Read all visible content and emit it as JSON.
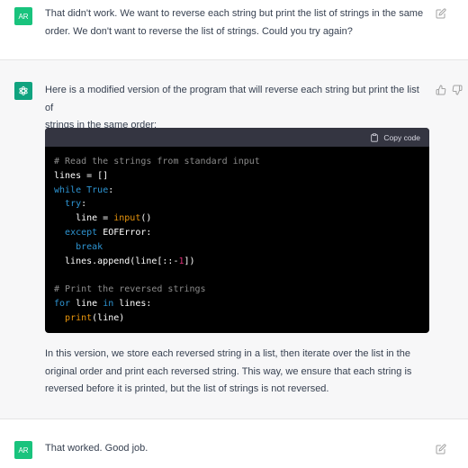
{
  "conversation": {
    "user_message_1": {
      "avatar": "AR",
      "lines": [
        "That didn't work. We want to reverse each string but print the list of strings in the same",
        "order. We don't want to reverse the list of strings. Could you try again?"
      ]
    },
    "assistant_message": {
      "intro_lines": [
        "Here is a modified version of the program that will reverse each string but print the list of",
        "strings in the same order:"
      ],
      "code": {
        "copy_label": "Copy code",
        "lines": [
          [
            {
              "t": "# Read the strings from standard input",
              "c": "c-comment"
            }
          ],
          [
            {
              "t": "lines = []",
              "c": ""
            }
          ],
          [
            {
              "t": "while",
              "c": "c-keyword"
            },
            {
              "t": " ",
              "c": ""
            },
            {
              "t": "True",
              "c": "c-keyword"
            },
            {
              "t": ":",
              "c": ""
            }
          ],
          [
            {
              "t": "  ",
              "c": ""
            },
            {
              "t": "try",
              "c": "c-keyword"
            },
            {
              "t": ":",
              "c": ""
            }
          ],
          [
            {
              "t": "    line = ",
              "c": ""
            },
            {
              "t": "input",
              "c": "c-builtin"
            },
            {
              "t": "()",
              "c": ""
            }
          ],
          [
            {
              "t": "  ",
              "c": ""
            },
            {
              "t": "except",
              "c": "c-keyword"
            },
            {
              "t": " EOFError:",
              "c": ""
            }
          ],
          [
            {
              "t": "    ",
              "c": ""
            },
            {
              "t": "break",
              "c": "c-keyword"
            }
          ],
          [
            {
              "t": "  lines.append(line[::-",
              "c": ""
            },
            {
              "t": "1",
              "c": "c-num"
            },
            {
              "t": "])",
              "c": ""
            }
          ],
          [
            {
              "t": "",
              "c": ""
            }
          ],
          [
            {
              "t": "# Print the reversed strings",
              "c": "c-comment"
            }
          ],
          [
            {
              "t": "for",
              "c": "c-keyword"
            },
            {
              "t": " line ",
              "c": ""
            },
            {
              "t": "in",
              "c": "c-keyword"
            },
            {
              "t": " lines:",
              "c": ""
            }
          ],
          [
            {
              "t": "  ",
              "c": ""
            },
            {
              "t": "print",
              "c": "c-builtin"
            },
            {
              "t": "(line)",
              "c": ""
            }
          ]
        ]
      },
      "outro_lines": [
        "In this version, we store each reversed string in a list, then iterate over the list in the",
        "original order and print each reversed string. This way, we ensure that each string is",
        "reversed before it is printed, but the list of strings is not reversed."
      ]
    },
    "user_message_2": {
      "avatar": "AR",
      "text": "That worked. Good job."
    }
  },
  "icons": {
    "edit": "edit-icon",
    "thumbs_up": "thumbs-up-icon",
    "thumbs_down": "thumbs-down-icon",
    "clipboard": "clipboard-icon",
    "assistant_logo": "openai-logo-icon"
  },
  "colors": {
    "user_avatar": "#19c37d",
    "assistant_avatar": "#10a37f",
    "assistant_bg": "#f7f7f8",
    "code_bg": "#000000",
    "code_header_bg": "#343541"
  }
}
